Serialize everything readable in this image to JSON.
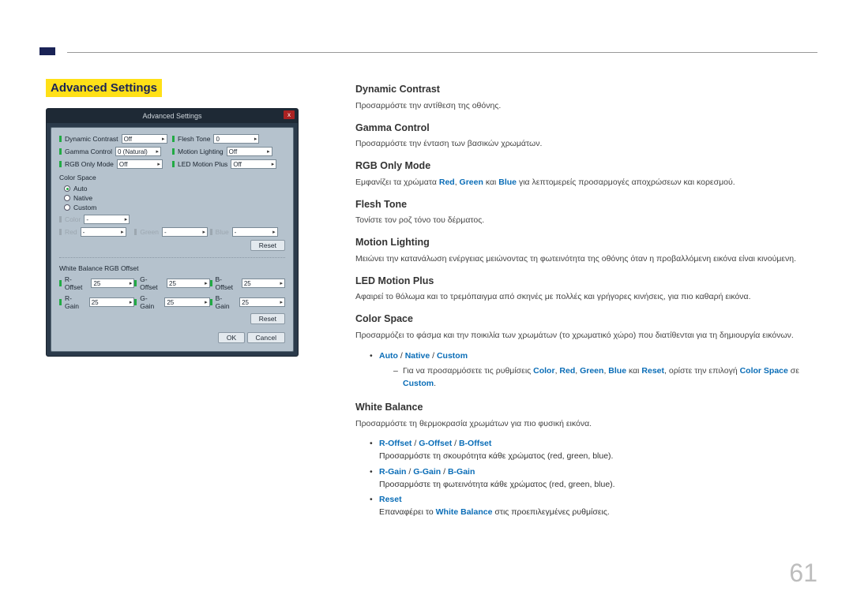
{
  "page": {
    "number": "61"
  },
  "left": {
    "heading": "Advanced Settings",
    "dialog_title": "Advanced Settings",
    "close": "x",
    "rows": {
      "dynamic_contrast": {
        "label": "Dynamic Contrast",
        "value": "Off"
      },
      "flesh_tone": {
        "label": "Flesh Tone",
        "value": "0"
      },
      "gamma_control": {
        "label": "Gamma Control",
        "value": "0 (Natural)"
      },
      "motion_lighting": {
        "label": "Motion Lighting",
        "value": "Off"
      },
      "rgb_only": {
        "label": "RGB Only Mode",
        "value": "Off"
      },
      "led_motion": {
        "label": "LED Motion Plus",
        "value": "Off"
      }
    },
    "color_space": {
      "header": "Color Space",
      "auto": "Auto",
      "native": "Native",
      "custom": "Custom",
      "color": "Color",
      "color_val": "-",
      "red": "Red",
      "red_val": "-",
      "green": "Green",
      "green_val": "-",
      "blue": "Blue",
      "blue_val": "-",
      "reset": "Reset"
    },
    "wb": {
      "header": "White Balance RGB Offset",
      "roffset": "R-Offset",
      "roffset_v": "25",
      "goffset": "G-Offset",
      "goffset_v": "25",
      "boffset": "B-Offset",
      "boffset_v": "25",
      "rgain": "R-Gain",
      "rgain_v": "25",
      "ggain": "G-Gain",
      "ggain_v": "25",
      "bgain": "B-Gain",
      "bgain_v": "25",
      "reset": "Reset"
    },
    "ok": "OK",
    "cancel": "Cancel"
  },
  "right": {
    "dc_t": "Dynamic Contrast",
    "dc_d": "Προσαρμόστε την αντίθεση της οθόνης.",
    "gc_t": "Gamma Control",
    "gc_d": "Προσαρμόστε την ένταση των βασικών χρωμάτων.",
    "rgb_t": "RGB Only Mode",
    "rgb_d_pre": "Εμφανίζει τα χρώματα ",
    "rgb_red": "Red",
    "rgb_comma1": ", ",
    "rgb_green": "Green",
    "rgb_and": " και ",
    "rgb_blue": "Blue",
    "rgb_d_post": " για λεπτομερείς προσαρμογές αποχρώσεων και κορεσμού.",
    "ft_t": "Flesh Tone",
    "ft_d": "Τονίστε τον ροζ τόνο του δέρματος.",
    "ml_t": "Motion Lighting",
    "ml_d": "Μειώνει την κατανάλωση ενέργειας μειώνοντας τη φωτεινότητα της οθόνης όταν η προβαλλόμενη εικόνα είναι κινούμενη.",
    "lmp_t": "LED Motion Plus",
    "lmp_d": "Αφαιρεί το θόλωμα και το τρεμόπαιγμα από σκηνές με πολλές και γρήγορες κινήσεις, για πιο καθαρή εικόνα.",
    "cs_t": "Color Space",
    "cs_d": "Προσαρμόζει το φάσμα και την ποικιλία των χρωμάτων (το χρωματικό χώρο) που διατίθενται για τη δημιουργία εικόνων.",
    "cs_auto": "Auto",
    "cs_sep": " / ",
    "cs_native": "Native",
    "cs_custom": "Custom",
    "cs_sub_pre": "Για να προσαρμόσετε τις ρυθμίσεις ",
    "cs_sub_color": "Color",
    "cs_sub_c1": ", ",
    "cs_sub_red": "Red",
    "cs_sub_c2": ", ",
    "cs_sub_green": "Green",
    "cs_sub_c3": ", ",
    "cs_sub_blue": "Blue",
    "cs_sub_and": " και ",
    "cs_sub_reset": "Reset",
    "cs_sub_mid": ", ορίστε την επιλογή ",
    "cs_sub_cspace": "Color Space",
    "cs_sub_in": " σε ",
    "cs_sub_custom2": "Custom",
    "cs_sub_dot": ".",
    "wb_t": "White Balance",
    "wb_d": "Προσαρμόστε τη θερμοκρασία χρωμάτων για πιο φυσική εικόνα.",
    "wb_roff": "R-Offset",
    "wb_goff": "G-Offset",
    "wb_boff": "B-Offset",
    "wb_off_d": "Προσαρμόστε τη σκουρότητα κάθε χρώματος (red, green, blue).",
    "wb_rgain": "R-Gain",
    "wb_ggain": "G-Gain",
    "wb_bgain": "B-Gain",
    "wb_gain_d": "Προσαρμόστε τη φωτεινότητα κάθε χρώματος (red, green, blue).",
    "wb_reset": "Reset",
    "wb_reset_pre": "Επαναφέρει το ",
    "wb_reset_kw": "White Balance",
    "wb_reset_post": " στις προεπιλεγμένες ρυθμίσεις."
  }
}
